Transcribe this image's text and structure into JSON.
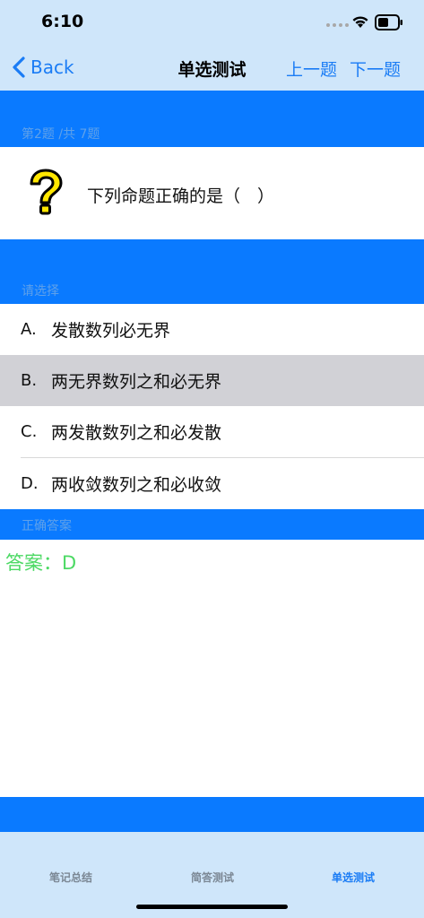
{
  "status": {
    "time": "6:10"
  },
  "nav": {
    "back_label": "Back",
    "title": "单选测试",
    "prev_label": "上一题",
    "next_label": "下一题"
  },
  "question": {
    "progress": "第2题 /共 7题",
    "text": "下列命题正确的是（　）"
  },
  "options_header": "请选择",
  "options": [
    {
      "letter": "A.",
      "text": "发散数列必无界",
      "selected": false
    },
    {
      "letter": "B.",
      "text": "两无界数列之和必无界",
      "selected": true
    },
    {
      "letter": "C.",
      "text": "两发散数列之和必发散",
      "selected": false
    },
    {
      "letter": "D.",
      "text": "两收敛数列之和必收敛",
      "selected": false
    }
  ],
  "answer_header": "正确答案",
  "answer_text": "答案：D",
  "tabs": [
    {
      "label": "笔记总结",
      "active": false
    },
    {
      "label": "简答测试",
      "active": false
    },
    {
      "label": "单选测试",
      "active": true
    }
  ],
  "colors": {
    "accent": "#1a7cf5",
    "band": "#0a7aff",
    "bar_background": "#cfe6fa",
    "answer": "#4cd964",
    "selected_row": "#d1d1d6"
  },
  "icons": [
    "wifi-icon",
    "battery-icon",
    "back-chevron-icon",
    "question-mark-icon"
  ]
}
